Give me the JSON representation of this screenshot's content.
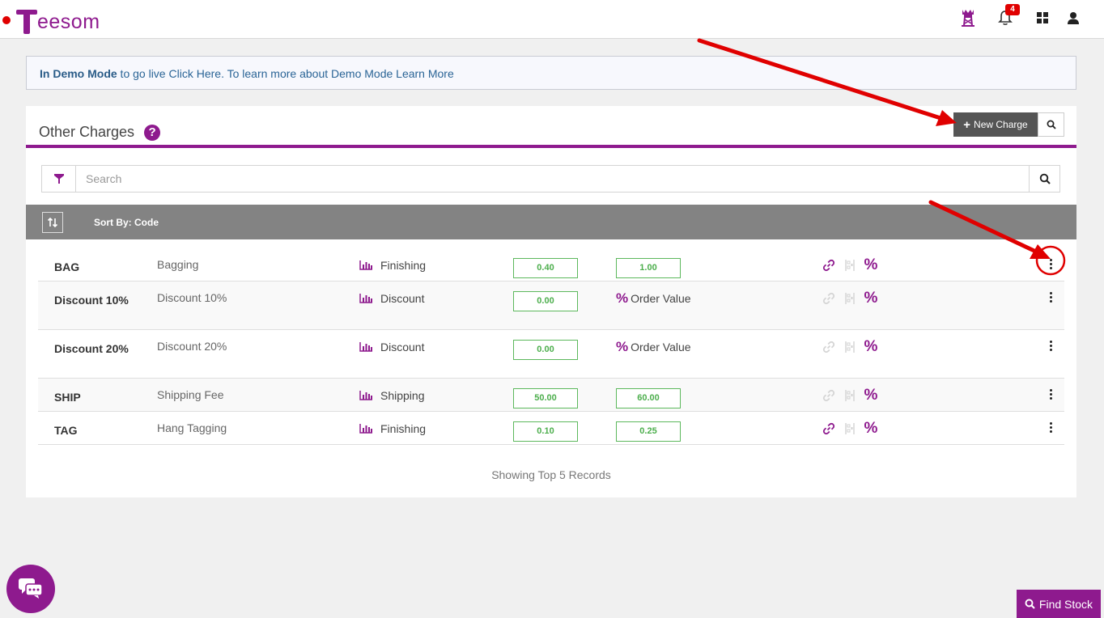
{
  "app": {
    "logo_text": "eesom",
    "notifications_count": "4"
  },
  "demo_banner": {
    "bold": "In Demo Mode",
    "part1": " to go live ",
    "link1": "Click Here.",
    "part2": " To learn more about Demo Mode ",
    "link2": "Learn More"
  },
  "panel": {
    "title": "Other Charges",
    "help": "?",
    "new_charge_label": "New Charge"
  },
  "search": {
    "placeholder": "Search"
  },
  "sort": {
    "label": "Sort By: Code"
  },
  "rows": [
    {
      "code": "BAG",
      "description": "Bagging",
      "category": "Finishing",
      "value1": "0.40",
      "value2": "1.00",
      "link_active": true
    },
    {
      "code": "Discount 10%",
      "description": "Discount 10%",
      "category": "Discount",
      "value1": "0.00",
      "value2_label": "Order Value",
      "link_active": false
    },
    {
      "code": "Discount 20%",
      "description": "Discount 20%",
      "category": "Discount",
      "value1": "0.00",
      "value2_label": "Order Value",
      "link_active": false
    },
    {
      "code": "SHIP",
      "description": "Shipping Fee",
      "category": "Shipping",
      "value1": "50.00",
      "value2": "60.00",
      "link_active": false
    },
    {
      "code": "TAG",
      "description": "Hang Tagging",
      "category": "Finishing",
      "value1": "0.10",
      "value2": "0.25",
      "link_active": true
    }
  ],
  "footer": {
    "records_text": "Showing Top 5 Records",
    "find_stock_label": "Find Stock"
  },
  "colors": {
    "brand": "#8e1a8e",
    "annotation": "#e00000",
    "value_border": "#5cb85c"
  }
}
